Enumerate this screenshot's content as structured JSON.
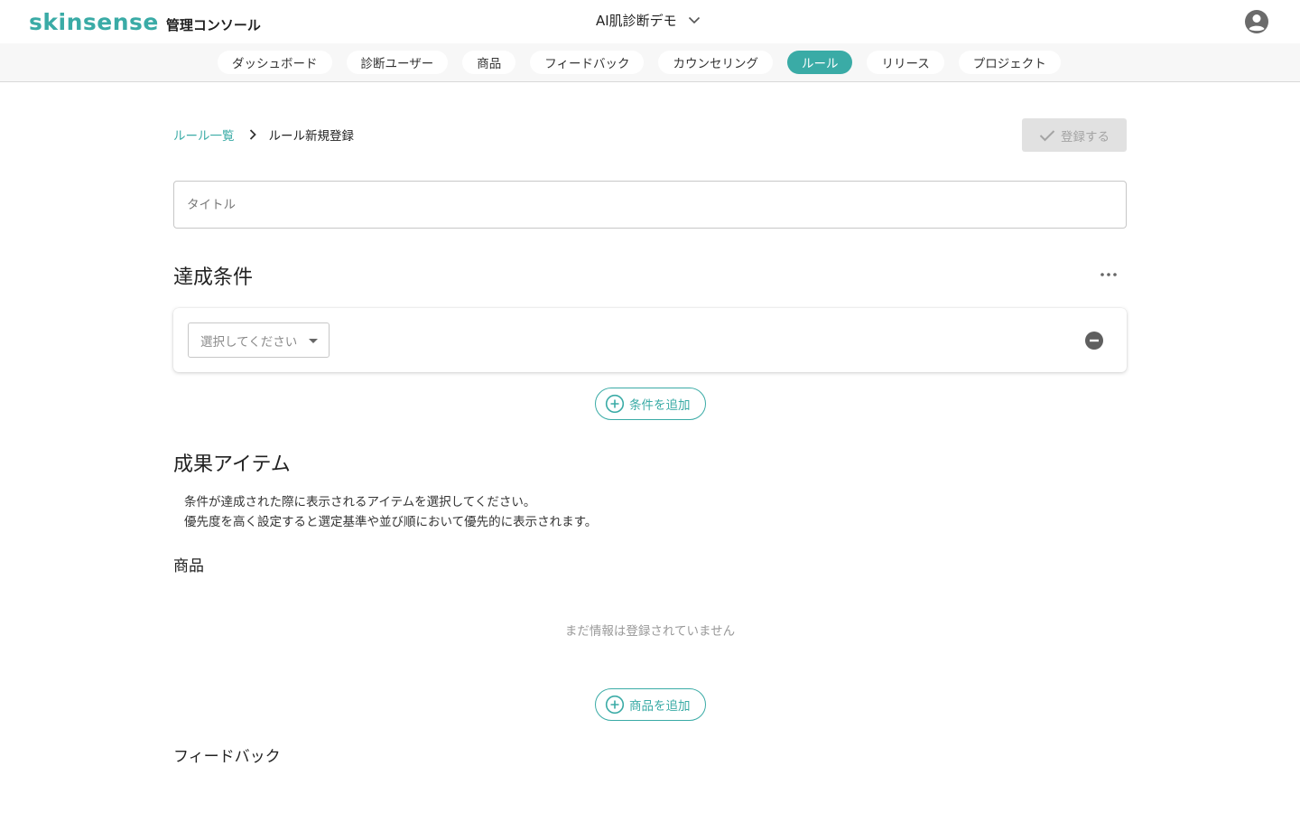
{
  "header": {
    "logo": "skinsense",
    "console_label": "管理コンソール",
    "project": "AI肌診断デモ"
  },
  "tabs": [
    {
      "label": "ダッシュボード",
      "active": false
    },
    {
      "label": "診断ユーザー",
      "active": false
    },
    {
      "label": "商品",
      "active": false
    },
    {
      "label": "フィードバック",
      "active": false
    },
    {
      "label": "カウンセリング",
      "active": false
    },
    {
      "label": "ルール",
      "active": true
    },
    {
      "label": "リリース",
      "active": false
    },
    {
      "label": "プロジェクト",
      "active": false
    }
  ],
  "breadcrumb": {
    "parent": "ルール一覧",
    "current": "ルール新規登録"
  },
  "register_button": "登録する",
  "title_input": {
    "placeholder": "タイトル",
    "value": ""
  },
  "conditions": {
    "heading": "達成条件",
    "select_placeholder": "選択してください",
    "add_label": "条件を追加"
  },
  "results": {
    "heading": "成果アイテム",
    "description_1": "条件が達成された際に表示されるアイテムを選択してください。",
    "description_2": "優先度を高く設定すると選定基準や並び順において優先的に表示されます。",
    "products_heading": "商品",
    "products_empty": "まだ情報は登録されていません",
    "products_add_label": "商品を追加",
    "feedback_heading": "フィードバック"
  },
  "colors": {
    "accent": "#3aaba6",
    "disabled_bg": "#e1e1e1",
    "disabled_text": "#a4a4a4"
  }
}
